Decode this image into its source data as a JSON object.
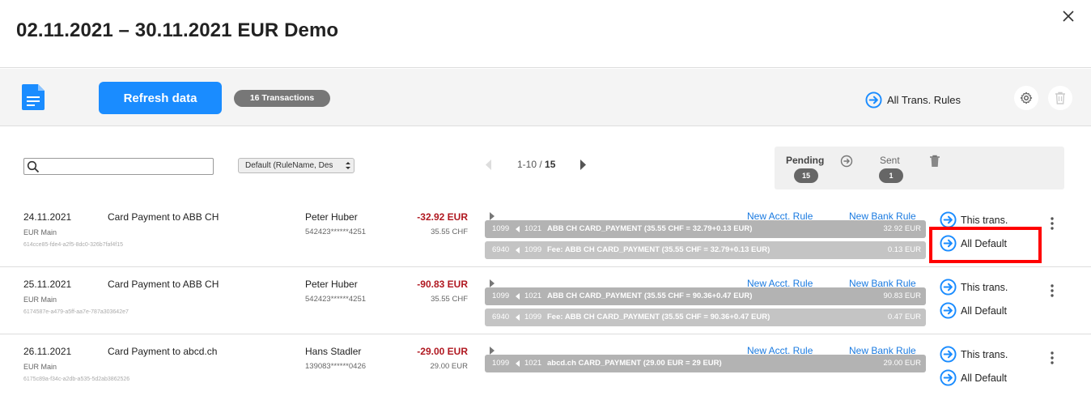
{
  "header": {
    "title": "02.11.2021 – 30.11.2021 EUR Demo"
  },
  "toolbar": {
    "refresh_label": "Refresh data",
    "transactions_badge": "16 Transactions",
    "all_rules_label": "All Trans. Rules"
  },
  "filters": {
    "search_value": "",
    "sort_selected": "Default (RuleName, Des"
  },
  "pager": {
    "range": "1-10",
    "separator": " / ",
    "total": "15"
  },
  "status": {
    "pending_label": "Pending",
    "pending_count": "15",
    "sent_label": "Sent",
    "sent_count": "1"
  },
  "transactions": [
    {
      "date": "24.11.2021",
      "account": "EUR Main",
      "uuid": "614cce85-fde4-a2f5-8dc0-326b7faf4f15",
      "description": "Card Payment to ABB CH",
      "name": "Peter Huber",
      "card": "542423******4251",
      "amount": "-32.92 EUR",
      "original_amount": "35.55 CHF",
      "new_acct_rule": "New Acct. Rule",
      "new_bank_rule": "New Bank Rule",
      "bookings": [
        {
          "account_from": "1099",
          "account_to": "1021",
          "text": "ABB CH CARD_PAYMENT (35.55 CHF = 32.79+0.13 EUR)",
          "amount": "32.92 EUR"
        },
        {
          "account_from": "6940",
          "account_to": "1099",
          "text": "Fee: ABB CH CARD_PAYMENT (35.55 CHF = 32.79+0.13 EUR)",
          "amount": "0.13 EUR"
        }
      ],
      "this_trans_label": "This trans.",
      "all_default_label": "All Default"
    },
    {
      "date": "25.11.2021",
      "account": "EUR Main",
      "uuid": "6174587e-a479-a5ff-aa7e-787a303642e7",
      "description": "Card Payment to ABB CH",
      "name": "Peter Huber",
      "card": "542423******4251",
      "amount": "-90.83 EUR",
      "original_amount": "35.55 CHF",
      "new_acct_rule": "New Acct. Rule",
      "new_bank_rule": "New Bank Rule",
      "bookings": [
        {
          "account_from": "1099",
          "account_to": "1021",
          "text": "ABB CH CARD_PAYMENT (35.55 CHF = 90.36+0.47 EUR)",
          "amount": "90.83 EUR"
        },
        {
          "account_from": "6940",
          "account_to": "1099",
          "text": "Fee: ABB CH CARD_PAYMENT (35.55 CHF = 90.36+0.47 EUR)",
          "amount": "0.47 EUR"
        }
      ],
      "this_trans_label": "This trans.",
      "all_default_label": "All Default"
    },
    {
      "date": "26.11.2021",
      "account": "EUR Main",
      "uuid": "6175c89a-f34c-a2db-a535-5d2ab3862526",
      "description": "Card Payment to abcd.ch",
      "name": "Hans Stadler",
      "card": "139083******0426",
      "amount": "-29.00 EUR",
      "original_amount": "29.00 EUR",
      "new_acct_rule": "New Acct. Rule",
      "new_bank_rule": "New Bank Rule",
      "bookings": [
        {
          "account_from": "1099",
          "account_to": "1021",
          "text": "abcd.ch CARD_PAYMENT (29.00 EUR = 29 EUR)",
          "amount": "29.00 EUR"
        }
      ],
      "this_trans_label": "This trans.",
      "all_default_label": "All Default"
    }
  ],
  "icons": {
    "close": "close-icon",
    "document": "document-icon",
    "circle_arrow": "circle-arrow-right-icon",
    "gear": "gear-icon",
    "trash": "trash-icon",
    "search": "search-icon",
    "kebab": "kebab-menu-icon"
  },
  "colors": {
    "primary": "#1a8cff",
    "link": "#1a7ae0",
    "negative_amount": "#b01820",
    "highlight": "#ff0000"
  }
}
